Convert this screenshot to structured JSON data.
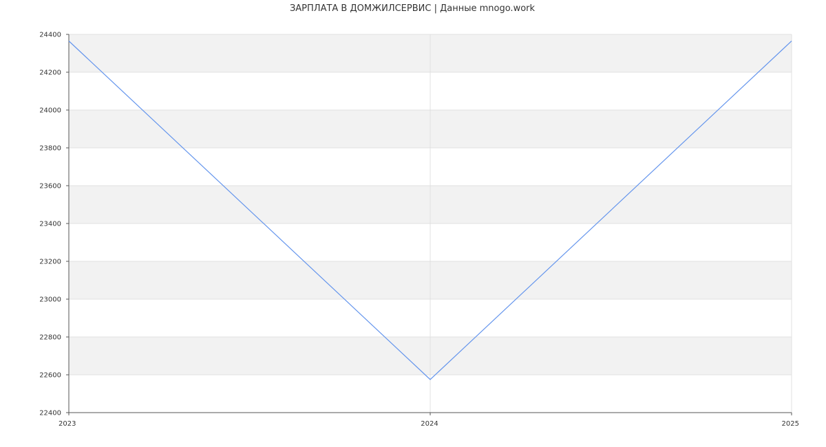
{
  "chart_data": {
    "type": "line",
    "title": "ЗАРПЛАТА В ДОМЖИЛСЕРВИС | Данные mnogo.work",
    "xlabel": "",
    "ylabel": "",
    "categories": [
      "2023",
      "2024",
      "2025"
    ],
    "series": [
      {
        "values": [
          24365,
          22575,
          24365
        ]
      }
    ],
    "ylim": [
      22400,
      24400
    ],
    "yticks": [
      22400,
      22600,
      22800,
      23000,
      23200,
      23400,
      23600,
      23800,
      24000,
      24200,
      24400
    ],
    "grid": true,
    "legend": "none",
    "colors": {
      "line": "#6495ed",
      "band": "#f2f2f2",
      "gridline": "#e0e0e0",
      "axis": "#555555",
      "text": "#333333"
    }
  }
}
